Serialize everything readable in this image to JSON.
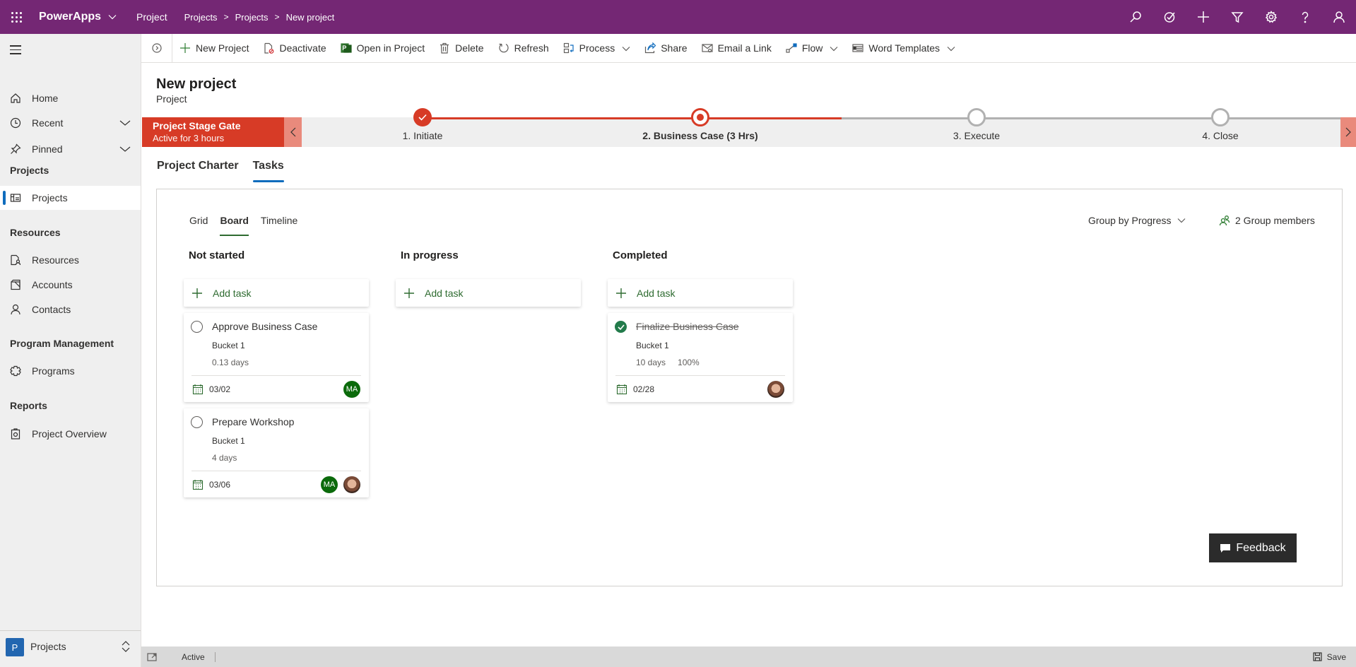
{
  "topbar": {
    "app_name": "PowerApps",
    "area": "Project",
    "breadcrumb": [
      "Projects",
      "Projects",
      "New project"
    ],
    "icons": [
      "search-icon",
      "task-check-icon",
      "plus-icon",
      "filter-icon",
      "settings-icon",
      "help-icon",
      "user-icon"
    ]
  },
  "sidebar": {
    "items_top": [
      {
        "label": "Home",
        "icon": "home-icon"
      },
      {
        "label": "Recent",
        "icon": "clock-icon",
        "expandable": true
      },
      {
        "label": "Pinned",
        "icon": "pin-icon",
        "expandable": true
      }
    ],
    "groups": [
      {
        "title": "Projects",
        "items": [
          {
            "label": "Projects",
            "icon": "projects-icon",
            "selected": true
          }
        ]
      },
      {
        "title": "Resources",
        "items": [
          {
            "label": "Resources",
            "icon": "resources-icon"
          },
          {
            "label": "Accounts",
            "icon": "accounts-icon"
          },
          {
            "label": "Contacts",
            "icon": "contact-icon"
          }
        ]
      },
      {
        "title": "Program Management",
        "items": [
          {
            "label": "Programs",
            "icon": "programs-icon"
          }
        ]
      },
      {
        "title": "Reports",
        "items": [
          {
            "label": "Project Overview",
            "icon": "report-icon"
          }
        ]
      }
    ],
    "area_switcher": {
      "badge": "P",
      "label": "Projects"
    }
  },
  "commandbar": {
    "commands": [
      {
        "label": "New Project",
        "icon": "plus-icon"
      },
      {
        "label": "Deactivate",
        "icon": "deactivate-icon"
      },
      {
        "label": "Open in Project",
        "icon": "project-app-icon"
      },
      {
        "label": "Delete",
        "icon": "trash-icon"
      },
      {
        "label": "Refresh",
        "icon": "refresh-icon"
      },
      {
        "label": "Process",
        "icon": "process-icon",
        "dropdown": true
      },
      {
        "label": "Share",
        "icon": "share-icon"
      },
      {
        "label": "Email a Link",
        "icon": "email-link-icon"
      },
      {
        "label": "Flow",
        "icon": "flow-icon",
        "dropdown": true
      },
      {
        "label": "Word Templates",
        "icon": "word-icon",
        "dropdown": true
      }
    ]
  },
  "record": {
    "title": "New project",
    "entity": "Project"
  },
  "stage_gate": {
    "name": "Project Stage Gate",
    "status": "Active for 3 hours",
    "accent": "#d73b26",
    "stages": [
      {
        "label": "1. Initiate",
        "state": "done"
      },
      {
        "label": "2. Business Case  (3 Hrs)",
        "state": "active"
      },
      {
        "label": "3. Execute",
        "state": "pending"
      },
      {
        "label": "4. Close",
        "state": "pending"
      }
    ]
  },
  "tabs": [
    {
      "label": "Project Charter",
      "active": false
    },
    {
      "label": "Tasks",
      "active": true
    }
  ],
  "tasks": {
    "views": [
      {
        "label": "Grid",
        "active": false
      },
      {
        "label": "Board",
        "active": true
      },
      {
        "label": "Timeline",
        "active": false
      }
    ],
    "group_by": "Group by Progress",
    "members": "2 Group members",
    "add_task_label": "Add task",
    "columns": [
      {
        "title": "Not started",
        "cards": [
          {
            "title": "Approve Business Case",
            "bucket": "Bucket 1",
            "duration": "0.13 days",
            "progress": "",
            "due": "03/02",
            "completed": false,
            "assignees": [
              "MA"
            ]
          },
          {
            "title": "Prepare Workshop",
            "bucket": "Bucket 1",
            "duration": "4 days",
            "progress": "",
            "due": "03/06",
            "completed": false,
            "assignees": [
              "MA",
              "photo"
            ]
          }
        ]
      },
      {
        "title": "In progress",
        "cards": []
      },
      {
        "title": "Completed",
        "cards": [
          {
            "title": "Finalize Business Case",
            "bucket": "Bucket 1",
            "duration": "10 days",
            "progress": "100%",
            "due": "02/28",
            "completed": true,
            "assignees": [
              "photo"
            ]
          }
        ]
      }
    ]
  },
  "feedback_label": "Feedback",
  "statusbar": {
    "status": "Active",
    "save_label": "Save"
  }
}
